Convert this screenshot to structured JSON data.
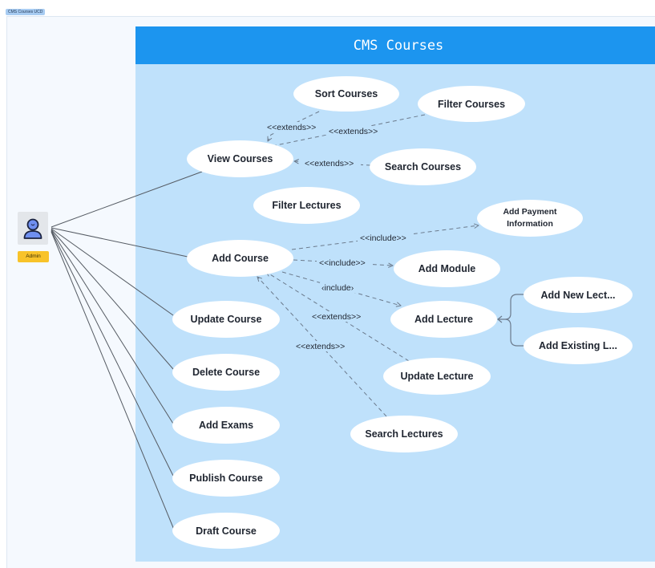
{
  "frame": {
    "label": "CMS Courses UCD"
  },
  "system": {
    "title": "CMS Courses"
  },
  "actor": {
    "name": "Admin",
    "icon": "user-icon"
  },
  "use_cases": {
    "sort_courses": "Sort Courses",
    "filter_courses": "Filter Courses",
    "view_courses": "View Courses",
    "search_courses": "Search Courses",
    "filter_lectures": "Filter Lectures",
    "add_payment_information": "Add Payment Information",
    "add_course": "Add Course",
    "add_module": "Add Module",
    "add_new_lecture": "Add New Lect...",
    "add_lecture": "Add Lecture",
    "add_existing_lecture": "Add Existing L...",
    "update_course": "Update Course",
    "update_lecture": "Update Lecture",
    "delete_course": "Delete Course",
    "add_exams": "Add Exams",
    "search_lectures": "Search Lectures",
    "publish_course": "Publish Course",
    "draft_course": "Draft Course"
  },
  "relations": {
    "extends_sort": "<<extends>>",
    "extends_filter": "<<extends>>",
    "extends_search": "<<extends>>",
    "include_payment": "<<include>>",
    "include_module": "<<include>>",
    "include_lecture": "‹include›",
    "extends_update_lecture": "<<extends>>",
    "extends_search_lectures": "<<extends>>"
  },
  "colors": {
    "header": "#1c95ef",
    "boundary": "#bfe1fb",
    "actor_label": "#f8c32a",
    "connector": "#6b7a8c"
  }
}
